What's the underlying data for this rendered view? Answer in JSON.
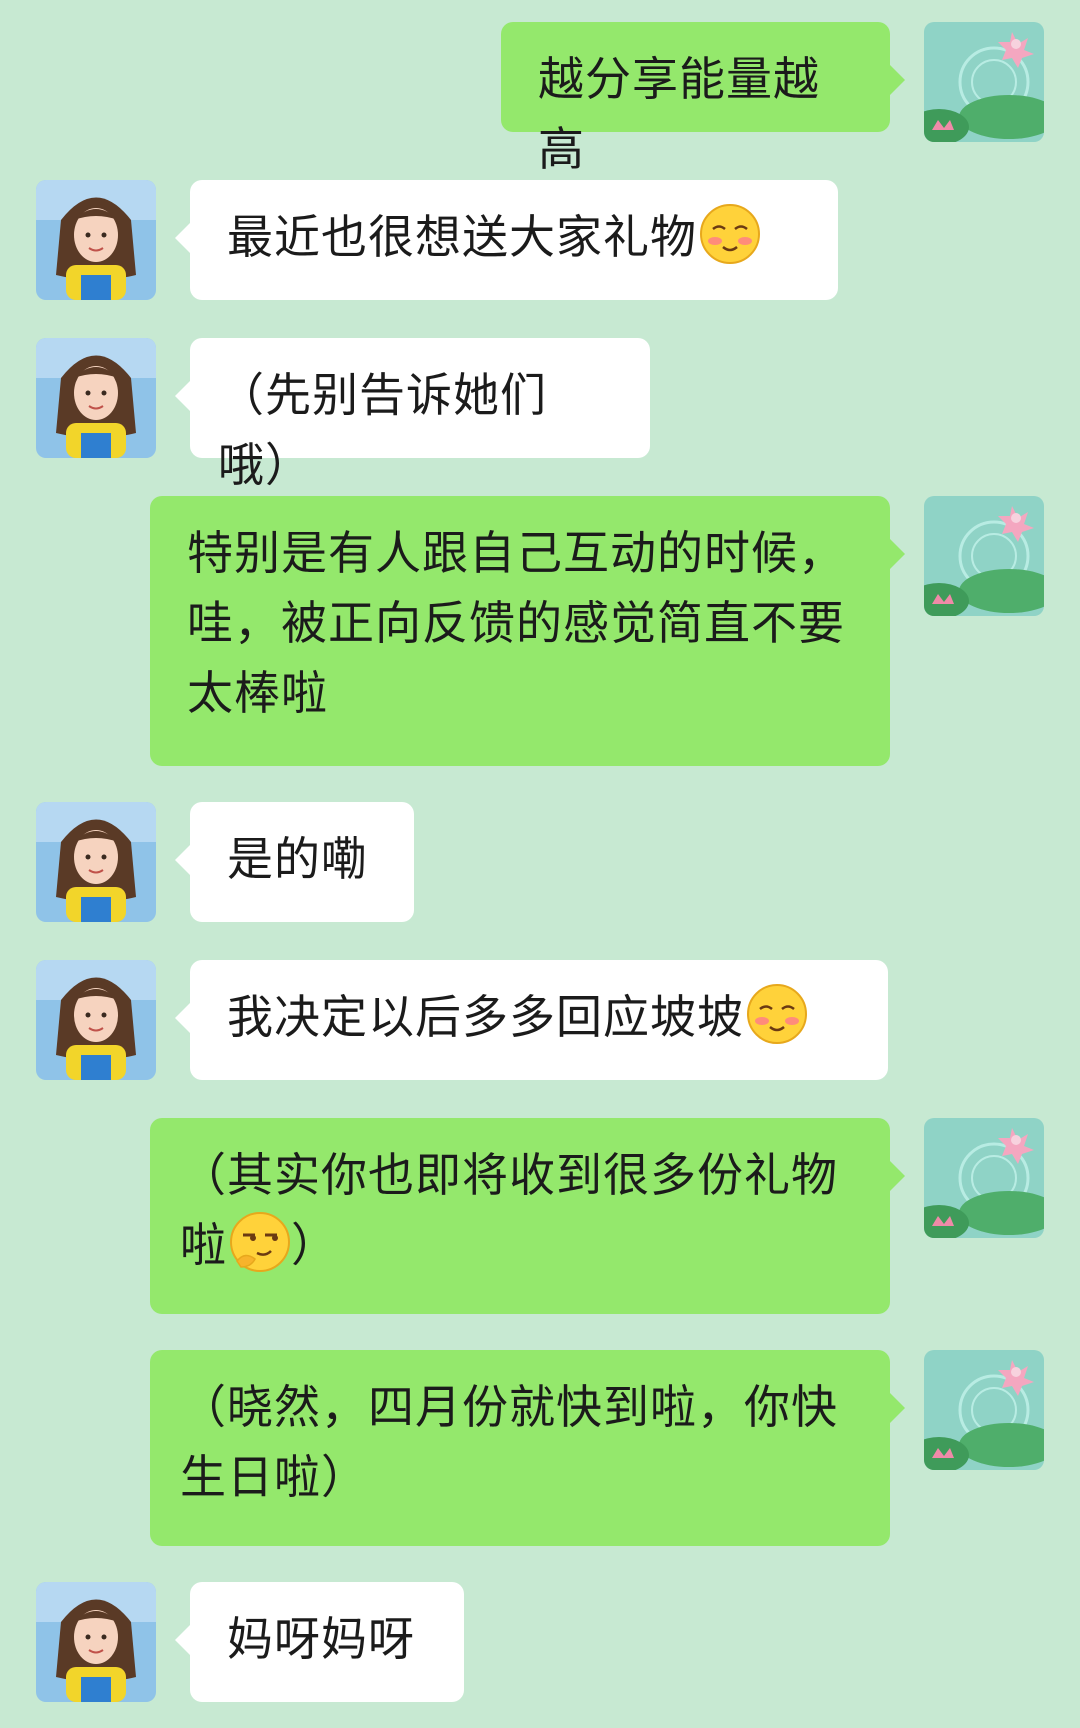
{
  "colors": {
    "background": "#c7e9d2",
    "incoming_bubble": "#ffffff",
    "outgoing_bubble": "#94e86c"
  },
  "messages": [
    {
      "sender": "me",
      "text": "越分享能量越高",
      "emoji_after": null
    },
    {
      "sender": "other",
      "text": "最近也很想送大家礼物",
      "emoji_after": "shy-smile-emoji"
    },
    {
      "sender": "other",
      "text": "（先别告诉她们哦）",
      "emoji_after": null
    },
    {
      "sender": "me",
      "text": "特别是有人跟自己互动的时候，哇，被正向反馈的感觉简直不要太棒啦",
      "emoji_after": null
    },
    {
      "sender": "other",
      "text": "是的嘞",
      "emoji_after": null
    },
    {
      "sender": "other",
      "text": "我决定以后多多回应坡坡",
      "emoji_after": "shy-smile-emoji"
    },
    {
      "sender": "me",
      "text": "（其实你也即将收到很多份礼物啦",
      "emoji_after": "smirk-emoji",
      "text_after": "）"
    },
    {
      "sender": "me",
      "text": "（晓然，四月份就快到啦，你快生日啦）",
      "emoji_after": null
    },
    {
      "sender": "other",
      "text": "妈呀妈呀",
      "emoji_after": null
    }
  ]
}
